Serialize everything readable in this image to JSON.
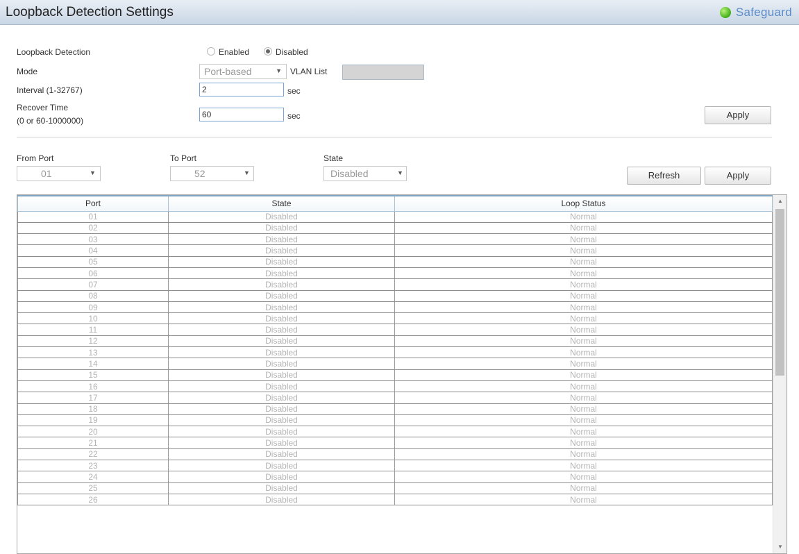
{
  "header": {
    "title": "Loopback Detection Settings",
    "safeguard_label": "Safeguard",
    "safeguard_color": "#3fae14"
  },
  "settings": {
    "loopback_label": "Loopback Detection",
    "enabled_label": "Enabled",
    "disabled_label": "Disabled",
    "selected": "Disabled",
    "mode_label": "Mode",
    "mode_value": "Port-based",
    "vlan_list_label": "VLAN List",
    "vlan_list_value": "",
    "interval_label": "Interval (1-32767)",
    "interval_value": "2",
    "interval_unit": "sec",
    "recover_label_1": "Recover Time",
    "recover_label_2": "(0 or 60-1000000)",
    "recover_value": "60",
    "recover_unit": "sec",
    "apply_label": "Apply"
  },
  "port_settings": {
    "from_port_label": "From Port",
    "from_port_value": "01",
    "to_port_label": "To Port",
    "to_port_value": "52",
    "state_label": "State",
    "state_value": "Disabled",
    "refresh_label": "Refresh",
    "apply_label": "Apply"
  },
  "table": {
    "columns": [
      "Port",
      "State",
      "Loop Status"
    ],
    "rows": [
      [
        "01",
        "Disabled",
        "Normal"
      ],
      [
        "02",
        "Disabled",
        "Normal"
      ],
      [
        "03",
        "Disabled",
        "Normal"
      ],
      [
        "04",
        "Disabled",
        "Normal"
      ],
      [
        "05",
        "Disabled",
        "Normal"
      ],
      [
        "06",
        "Disabled",
        "Normal"
      ],
      [
        "07",
        "Disabled",
        "Normal"
      ],
      [
        "08",
        "Disabled",
        "Normal"
      ],
      [
        "09",
        "Disabled",
        "Normal"
      ],
      [
        "10",
        "Disabled",
        "Normal"
      ],
      [
        "11",
        "Disabled",
        "Normal"
      ],
      [
        "12",
        "Disabled",
        "Normal"
      ],
      [
        "13",
        "Disabled",
        "Normal"
      ],
      [
        "14",
        "Disabled",
        "Normal"
      ],
      [
        "15",
        "Disabled",
        "Normal"
      ],
      [
        "16",
        "Disabled",
        "Normal"
      ],
      [
        "17",
        "Disabled",
        "Normal"
      ],
      [
        "18",
        "Disabled",
        "Normal"
      ],
      [
        "19",
        "Disabled",
        "Normal"
      ],
      [
        "20",
        "Disabled",
        "Normal"
      ],
      [
        "21",
        "Disabled",
        "Normal"
      ],
      [
        "22",
        "Disabled",
        "Normal"
      ],
      [
        "23",
        "Disabled",
        "Normal"
      ],
      [
        "24",
        "Disabled",
        "Normal"
      ],
      [
        "25",
        "Disabled",
        "Normal"
      ],
      [
        "26",
        "Disabled",
        "Normal"
      ]
    ]
  }
}
